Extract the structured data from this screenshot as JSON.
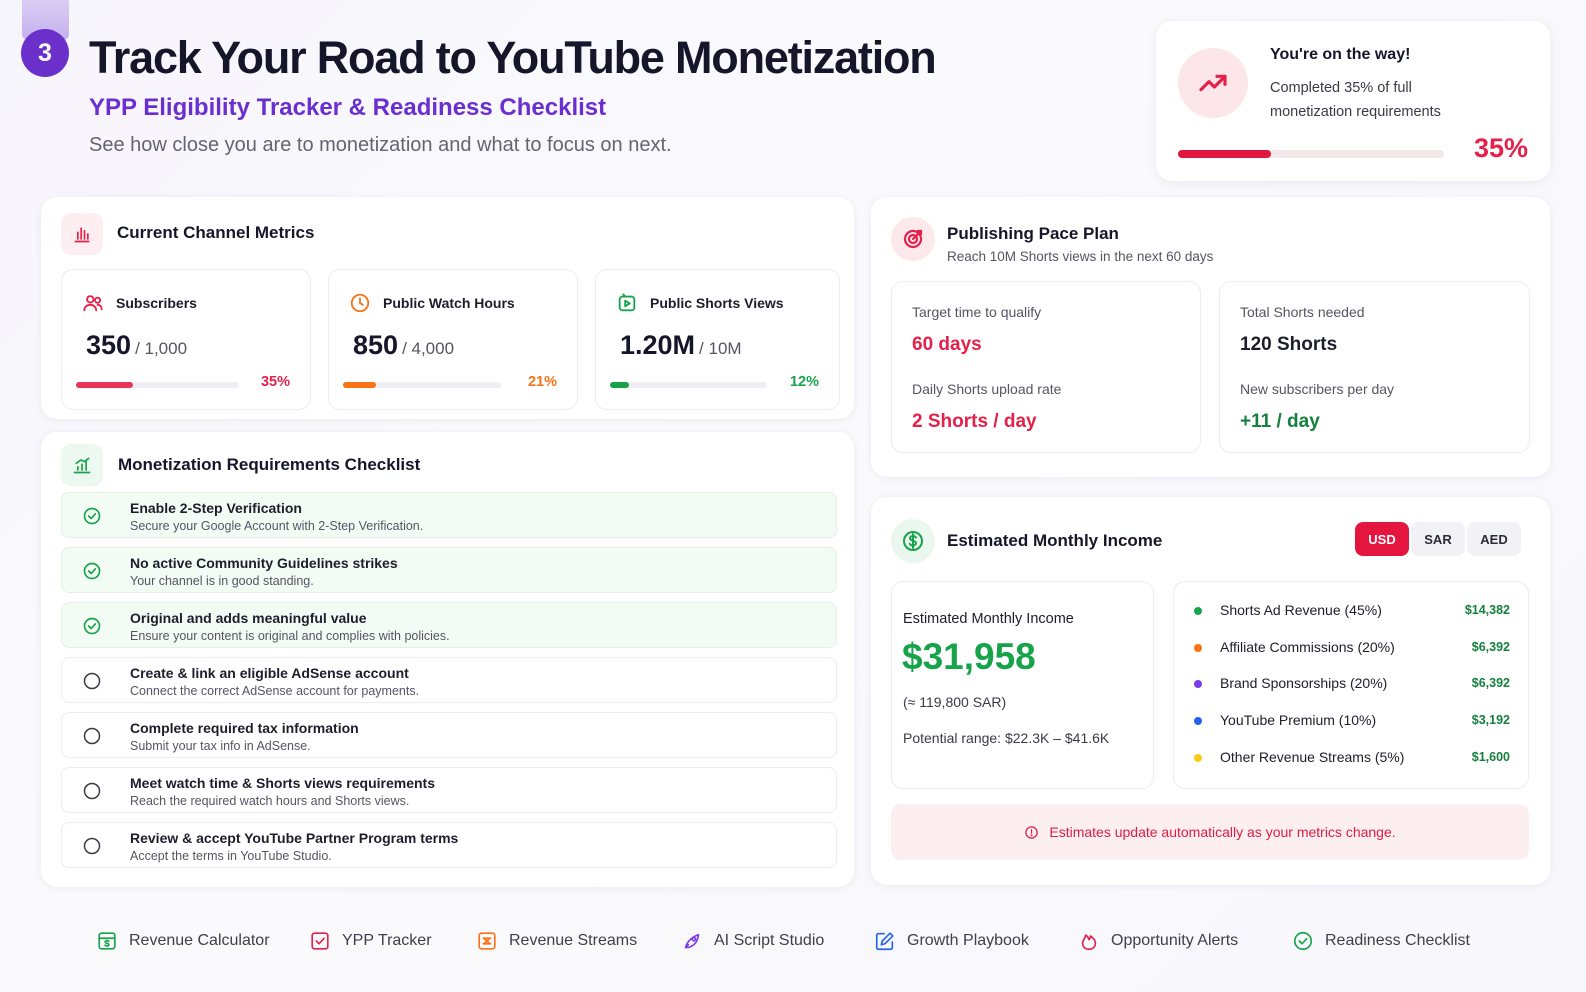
{
  "header": {
    "step": "3",
    "title": "Track Your Road to YouTube Monetization",
    "subtitle": "YPP Eligibility Tracker & Readiness Checklist",
    "description": "See how close you are to monetization and what to focus on next."
  },
  "progress_card": {
    "title": "You're on the way!",
    "text": "Completed 35% of full monetization requirements",
    "percent_label": "35%",
    "progress": 0.35,
    "icon": "trend-up-icon",
    "accent": "#e5214a"
  },
  "metrics": {
    "title": "Current Channel Metrics",
    "icon": "bar-chart-icon",
    "items": [
      {
        "label": "Subscribers",
        "value": "350",
        "target": "/ 1,000",
        "percent_label": "35%",
        "progress": 0.35,
        "color": "#e8365a",
        "icon": "users-icon"
      },
      {
        "label": "Public Watch Hours",
        "value": "850",
        "target": "/ 4,000",
        "percent_label": "21%",
        "progress": 0.21,
        "color": "#f97316",
        "icon": "clock-icon"
      },
      {
        "label": "Public Shorts Views",
        "value": "1.20M",
        "target": "/ 10M",
        "percent_label": "12%",
        "progress": 0.12,
        "color": "#16a34a",
        "icon": "play-square-icon"
      }
    ]
  },
  "checklist": {
    "title": "Monetization Requirements Checklist",
    "icon": "chart-growth-icon",
    "items": [
      {
        "title": "Enable 2-Step Verification",
        "desc": "Secure your Google Account with 2-Step Verification.",
        "done": true
      },
      {
        "title": "No active Community Guidelines strikes",
        "desc": "Your channel is in good standing.",
        "done": true
      },
      {
        "title": "Original and adds meaningful value",
        "desc": "Ensure your content is original and complies with policies.",
        "done": true
      },
      {
        "title": "Create & link an eligible AdSense account",
        "desc": "Connect the correct AdSense account for payments.",
        "done": false
      },
      {
        "title": "Complete required tax information",
        "desc": "Submit your tax info in AdSense.",
        "done": false
      },
      {
        "title": "Meet watch time & Shorts views requirements",
        "desc": "Reach the required watch hours and Shorts views.",
        "done": false
      },
      {
        "title": "Review & accept YouTube Partner Program terms",
        "desc": "Accept the terms in YouTube Studio.",
        "done": false
      }
    ]
  },
  "pace": {
    "title": "Publishing Pace Plan",
    "subtitle": "Reach 10M Shorts views in the next 60 days",
    "icon": "target-icon",
    "target_label": "Target time to qualify",
    "target_value": "60 days",
    "rate_label": "Daily Shorts upload rate",
    "rate_value": "2 Shorts / day",
    "total_label": "Total Shorts needed",
    "total_value": "120 Shorts",
    "subs_label": "New subscribers per day",
    "subs_value": "+11 / day"
  },
  "income": {
    "title": "Estimated Monthly Income",
    "icon": "dollar-icon",
    "currencies": [
      "USD",
      "SAR",
      "AED"
    ],
    "active_currency": "USD",
    "box_label": "Estimated Monthly Income",
    "amount": "$31,958",
    "converted": "(≈ 119,800 SAR)",
    "range": "Potential range: $22.3K – $41.6K",
    "streams": [
      {
        "label": "Shorts Ad Revenue (45%)",
        "amount": "$14,382",
        "color": "#16a34a"
      },
      {
        "label": "Affiliate Commissions (20%)",
        "amount": "$6,392",
        "color": "#f97316"
      },
      {
        "label": "Brand Sponsorships (20%)",
        "amount": "$6,392",
        "color": "#7c3aed"
      },
      {
        "label": "YouTube Premium (10%)",
        "amount": "$3,192",
        "color": "#2563eb"
      },
      {
        "label": "Other Revenue Streams (5%)",
        "amount": "$1,600",
        "color": "#facc15"
      }
    ],
    "notice": "Estimates update automatically as your metrics change.",
    "notice_icon": "info-icon"
  },
  "nav": [
    {
      "label": "Revenue Calculator",
      "icon": "calculator-icon",
      "color": "#16a34a"
    },
    {
      "label": "YPP Tracker",
      "icon": "checkbox-icon",
      "color": "#e5214a"
    },
    {
      "label": "Revenue Streams",
      "icon": "streams-icon",
      "color": "#f97316"
    },
    {
      "label": "AI Script Studio",
      "icon": "rocket-icon",
      "color": "#7c3aed"
    },
    {
      "label": "Growth Playbook",
      "icon": "edit-icon",
      "color": "#2563eb"
    },
    {
      "label": "Opportunity Alerts",
      "icon": "flame-icon",
      "color": "#e5214a"
    },
    {
      "label": "Readiness Checklist",
      "icon": "check-circle-icon",
      "color": "#16a34a"
    }
  ]
}
